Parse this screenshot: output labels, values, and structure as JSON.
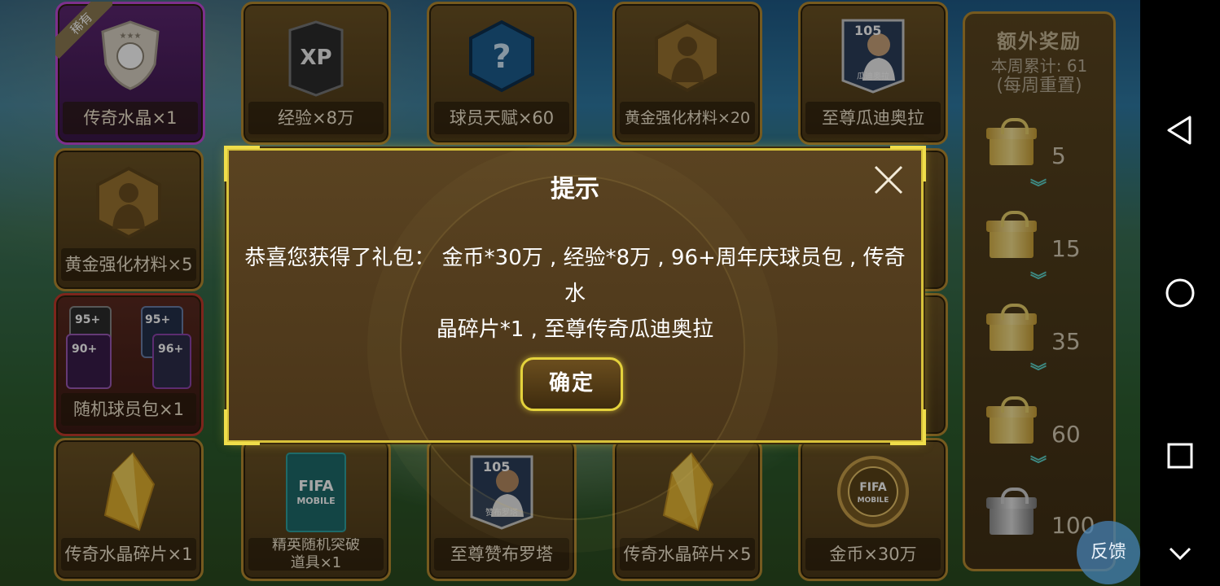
{
  "grid": {
    "row1": [
      {
        "label": "传奇水晶×1",
        "badge": "稀有",
        "style": "purple"
      },
      {
        "label": "经验×8万",
        "icon_text": "XP"
      },
      {
        "label": "球员天赋×60",
        "icon_text": "?"
      },
      {
        "label": "黄金强化材料×20"
      },
      {
        "label": "至尊瓜迪奥拉",
        "rating": "105",
        "player": "瓜迪奥拉"
      }
    ],
    "row2": [
      {
        "label": "黄金强化材料×5"
      }
    ],
    "row3": [
      {
        "label": "随机球员包×1",
        "style": "red",
        "ratings": [
          "95+",
          "95+",
          "90+",
          "96+"
        ]
      }
    ],
    "row4": [
      {
        "label": "传奇水晶碎片×1"
      },
      {
        "label_line1": "精英随机突破",
        "label_line2": "道具×1",
        "pack_text_1": "FIFA",
        "pack_text_2": "MOBILE"
      },
      {
        "label": "至尊赞布罗塔",
        "rating": "105",
        "player": "赞布罗塔"
      },
      {
        "label": "传奇水晶碎片×5"
      },
      {
        "label": "金币×30万",
        "coin_text_1": "FIFA",
        "coin_text_2": "MOBILE"
      }
    ]
  },
  "side_panel": {
    "title": "额外奖励",
    "week_total": "本周累计: 61",
    "reset_note": "(每周重置)",
    "milestones": [
      {
        "value": "5",
        "gift": "gold"
      },
      {
        "value": "15",
        "gift": "gold"
      },
      {
        "value": "35",
        "gift": "gold"
      },
      {
        "value": "60",
        "gift": "gold"
      },
      {
        "value": "100",
        "gift": "silver"
      }
    ]
  },
  "feedback_label": "反馈",
  "modal": {
    "title": "提示",
    "message_line1": "恭喜您获得了礼包： 金币*30万 , 经验*8万 , 96+周年庆球员包 , 传奇水",
    "message_line2": "晶碎片*1 , 至尊传奇瓜迪奥拉",
    "confirm_label": "确定",
    "accent": "#d8c23a"
  },
  "navbar": {
    "buttons": [
      "back-triangle",
      "home-circle",
      "recents-square",
      "collapse-chevron"
    ]
  }
}
